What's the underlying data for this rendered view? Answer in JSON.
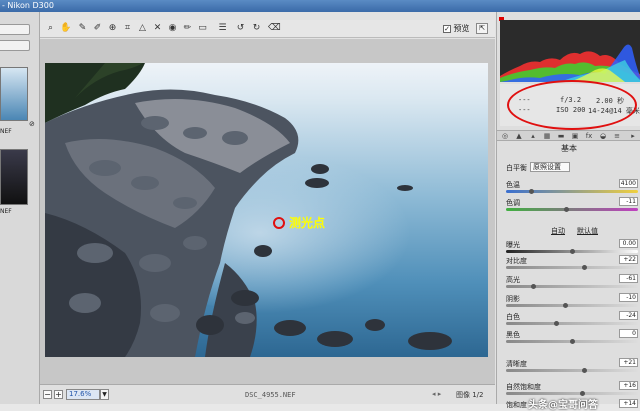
{
  "window": {
    "title": "- Nikon D300"
  },
  "filmstrip": {
    "thumbnails": [
      {
        "label": "NEF"
      },
      {
        "label": "NEF"
      }
    ]
  },
  "toolbar": {
    "tools": [
      "zoom-icon",
      "hand-icon",
      "eyedropper-icon",
      "color-sampler-icon",
      "target-adjust-icon",
      "crop-icon",
      "straighten-icon",
      "spot-removal-icon",
      "red-eye-icon",
      "brush-icon",
      "gradient-icon",
      "preferences-icon",
      "rotate-ccw-icon",
      "rotate-cw-icon",
      "trash-icon"
    ],
    "preview_label": "预览",
    "preview_checked": true
  },
  "canvas": {
    "meter_label": "测光点"
  },
  "bottombar": {
    "zoom_minus": "−",
    "zoom_plus": "+",
    "zoom_value": "17.6%",
    "filename": "DSC_4955.NEF",
    "page_info": "图像 1/2"
  },
  "exif": {
    "row1_left": "---",
    "row2_left": "---",
    "aperture": "f/3.2",
    "shutter": "2.00 秒",
    "iso": "ISO 200",
    "lens": "14-24@14 毫米"
  },
  "panel": {
    "section_title": "基本",
    "white_balance": {
      "label": "白平衡",
      "value": "原照设置"
    },
    "auto_label": "自动",
    "default_label": "默认值",
    "controls": [
      {
        "label": "色温",
        "value": "4100",
        "pos": 0.18,
        "grad": "linear-gradient(90deg,#3a6fd0,#f0d040)"
      },
      {
        "label": "色调",
        "value": "-11",
        "pos": 0.46,
        "grad": "linear-gradient(90deg,#40b040,#c040c0)"
      },
      {
        "label": "曝光",
        "value": "0.00",
        "pos": 0.5,
        "grad": "linear-gradient(90deg,#222,#fff)"
      },
      {
        "label": "对比度",
        "value": "+22",
        "pos": 0.6,
        "grad": "linear-gradient(90deg,#888,#ddd)"
      },
      {
        "label": "高光",
        "value": "-61",
        "pos": 0.2,
        "grad": "linear-gradient(90deg,#888,#ddd)"
      },
      {
        "label": "阴影",
        "value": "-10",
        "pos": 0.45,
        "grad": "linear-gradient(90deg,#888,#ddd)"
      },
      {
        "label": "白色",
        "value": "-24",
        "pos": 0.38,
        "grad": "linear-gradient(90deg,#888,#ddd)"
      },
      {
        "label": "黑色",
        "value": "0",
        "pos": 0.5,
        "grad": "linear-gradient(90deg,#888,#ddd)"
      },
      {
        "label": "清晰度",
        "value": "+21",
        "pos": 0.6,
        "grad": "linear-gradient(90deg,#888,#ddd)"
      },
      {
        "label": "自然饱和度",
        "value": "+16",
        "pos": 0.58,
        "grad": "linear-gradient(90deg,#888,#ddd)"
      },
      {
        "label": "饱和度",
        "value": "+14",
        "pos": 0.57,
        "grad": "linear-gradient(90deg,#888,#ddd)"
      }
    ]
  },
  "watermark": "头条@宝哥问答",
  "colors": {
    "accent_red": "#e01010",
    "meter_text": "#ffff00"
  }
}
